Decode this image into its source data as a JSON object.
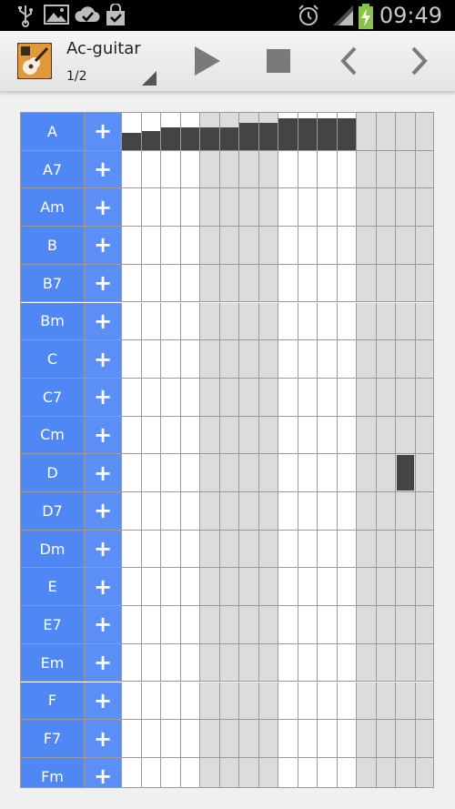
{
  "status_bar": {
    "time": "09:49",
    "icons": [
      "usb-icon",
      "image-icon",
      "check-cloud-icon",
      "shopping-bag-icon",
      "alarm-icon",
      "signal-icon",
      "battery-charging-icon"
    ]
  },
  "action_bar": {
    "title": "Ac-guitar",
    "subtitle": "1/2",
    "buttons": [
      "play",
      "stop",
      "previous",
      "next"
    ]
  },
  "grid": {
    "add_symbol": "+",
    "chords": [
      "A",
      "A7",
      "Am",
      "B",
      "B7",
      "Bm",
      "C",
      "C7",
      "Cm",
      "D",
      "D7",
      "Dm",
      "E",
      "E7",
      "Em",
      "F",
      "F7",
      "Fm"
    ],
    "columns": 16,
    "shaded_columns": [
      4,
      5,
      6,
      7,
      12,
      13,
      14,
      15
    ],
    "level_bars": [
      0.45,
      0.5,
      0.6,
      0.6,
      0.6,
      0.6,
      0.73,
      0.73,
      0.85,
      0.85,
      0.85,
      0.85
    ],
    "notes": [
      {
        "chord": "D",
        "column": 14
      }
    ]
  }
}
